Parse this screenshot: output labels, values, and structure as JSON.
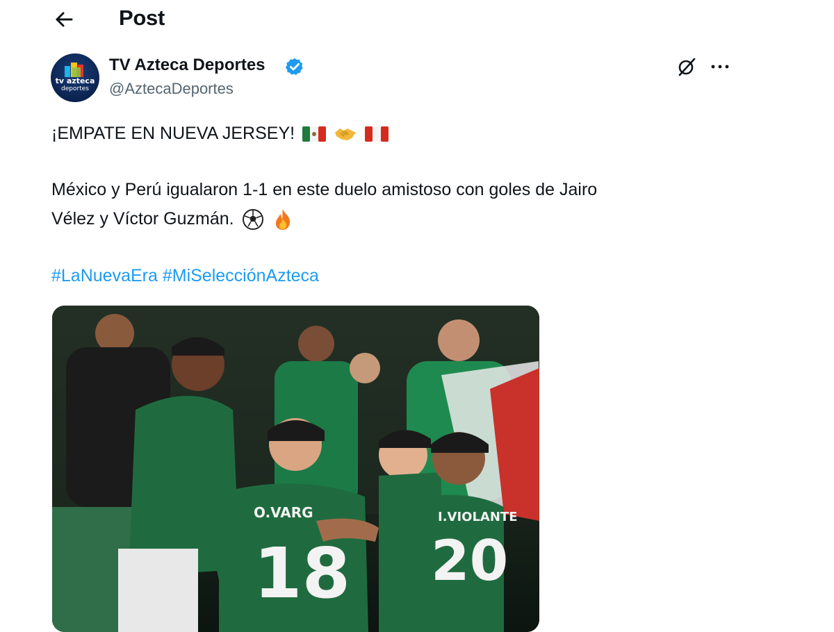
{
  "header": {
    "title": "Post",
    "back_icon": "arrow-left-icon"
  },
  "author": {
    "display_name": "TV Azteca Deportes",
    "handle": "@AztecaDeportes",
    "avatar_text_line1": "tv azteca",
    "avatar_text_line2": "deportes",
    "verified_icon": "verified-badge-icon",
    "verified_color": "#1d9bf0"
  },
  "actions": {
    "grok_icon": "grok-icon",
    "more_icon": "more-dots-icon"
  },
  "tweet": {
    "line1": "¡EMPATE EN NUEVA JERSEY!",
    "line2": "México y Perú igualaron 1-1 en este duelo amistoso con goles de Jairo",
    "line3": "Vélez y Víctor Guzmán.",
    "line1_emojis": [
      "mexico-flag",
      "handshake",
      "peru-flag"
    ],
    "line3_emojis": [
      "soccer-ball",
      "fire"
    ],
    "hashtags": [
      "#LaNuevaEra",
      "#MiSelecciónAzteca"
    ],
    "hashtag_color": "#1d9bf0"
  },
  "media": {
    "jersey_18_name": "O.VARG",
    "jersey_18_number": "18",
    "jersey_20_name": "I.VIOLANTE",
    "jersey_20_number": "20",
    "jersey_color": "#1f6b3f"
  }
}
